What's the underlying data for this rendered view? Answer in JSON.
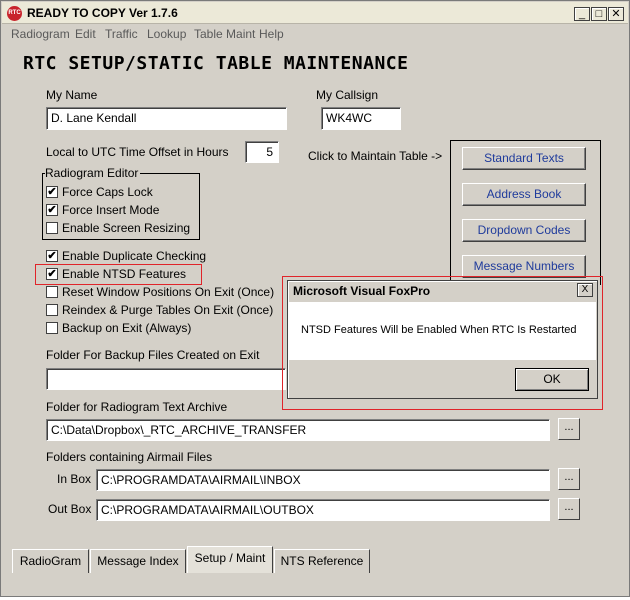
{
  "window": {
    "title": "READY TO COPY Ver 1.7.6",
    "app_icon": "RTC",
    "minimize": "_",
    "maximize": "□",
    "close": "✕"
  },
  "menu": [
    "Radiogram",
    "Edit",
    "Traffic",
    "Lookup",
    "Table Maint",
    "Help"
  ],
  "header": "RTC SETUP/STATIC TABLE MAINTENANCE",
  "name_label": "My Name",
  "name_value": "D. Lane Kendall",
  "callsign_label": "My Callsign",
  "callsign_value": "WK4WC",
  "utc_label": "Local to UTC Time Offset in Hours",
  "utc_value": "5",
  "maintain_label": "Click to Maintain Table ->",
  "editor_group": {
    "title": "Radiogram Editor",
    "items": [
      {
        "label": "Force Caps Lock",
        "checked": "✔"
      },
      {
        "label": "Force Insert Mode",
        "checked": "✔"
      },
      {
        "label": "Enable Screen Resizing",
        "checked": ""
      }
    ]
  },
  "options": [
    {
      "label": "Enable Duplicate Checking",
      "checked": "✔"
    },
    {
      "label": "Enable NTSD Features",
      "checked": "✔"
    },
    {
      "label": "Reset Window Positions On Exit (Once)",
      "checked": ""
    },
    {
      "label": "Reindex & Purge Tables On Exit (Once)",
      "checked": ""
    },
    {
      "label": "Backup on Exit (Always)",
      "checked": ""
    }
  ],
  "tables": [
    "Standard Texts",
    "Address Book",
    "Dropdown Codes",
    "Message Numbers"
  ],
  "backup_label": "Folder For Backup Files Created on Exit",
  "backup_value": "",
  "archive_label": "Folder for Radiogram Text Archive",
  "archive_value": "C:\\Data\\Dropbox\\_RTC_ARCHIVE_TRANSFER",
  "airmail_label": "Folders containing Airmail Files",
  "inbox_label": "In Box",
  "inbox_value": "C:\\PROGRAMDATA\\AIRMAIL\\INBOX",
  "outbox_label": "Out Box",
  "outbox_value": "C:\\PROGRAMDATA\\AIRMAIL\\OUTBOX",
  "browse": "...",
  "tabs": [
    "RadioGram",
    "Message Index",
    "Setup / Maint",
    "NTS Reference"
  ],
  "dialog": {
    "title": "Microsoft Visual FoxPro",
    "close": "X",
    "message": "NTSD Features Will be Enabled When RTC Is Restarted",
    "ok": "OK"
  },
  "colors": {
    "highlight": "#e0242a",
    "button_text": "#1f3b9c",
    "face": "#d4d0c8"
  }
}
